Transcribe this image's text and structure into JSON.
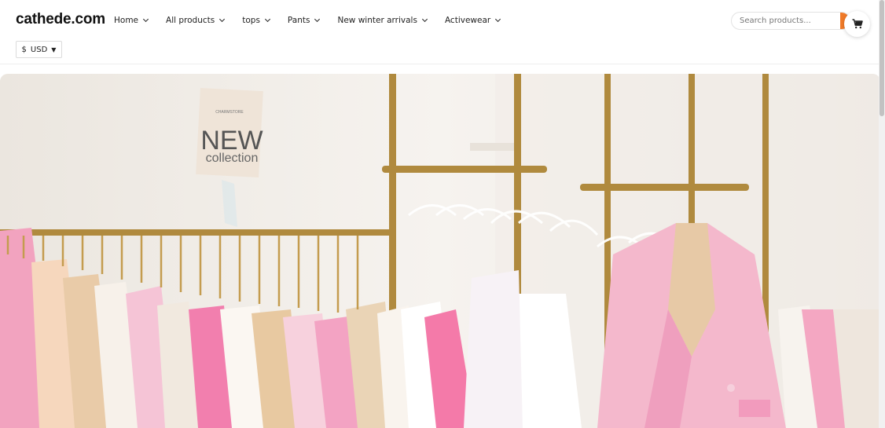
{
  "brand": {
    "logo": "cathede.com"
  },
  "nav": {
    "items": [
      {
        "label": "Home"
      },
      {
        "label": "All products"
      },
      {
        "label": "tops"
      },
      {
        "label": "Pants"
      },
      {
        "label": "New winter arrivals"
      },
      {
        "label": "Activewear"
      }
    ]
  },
  "search": {
    "placeholder": "Search products..."
  },
  "currency": {
    "symbol": "$",
    "code": "USD",
    "arrow": "▼"
  },
  "hero": {
    "sign_line1": "NEW",
    "sign_line2": "collection",
    "sign_brand": "CHARMSTORE"
  },
  "colors": {
    "accent": "#f07a28",
    "rack_gold": "#b08a3e",
    "pink": "#f2a6c2",
    "hot_pink": "#f27fae"
  },
  "icons": {
    "cart": "cart-icon",
    "chevron": "chevron-down-icon",
    "search_btn": "search-icon"
  }
}
